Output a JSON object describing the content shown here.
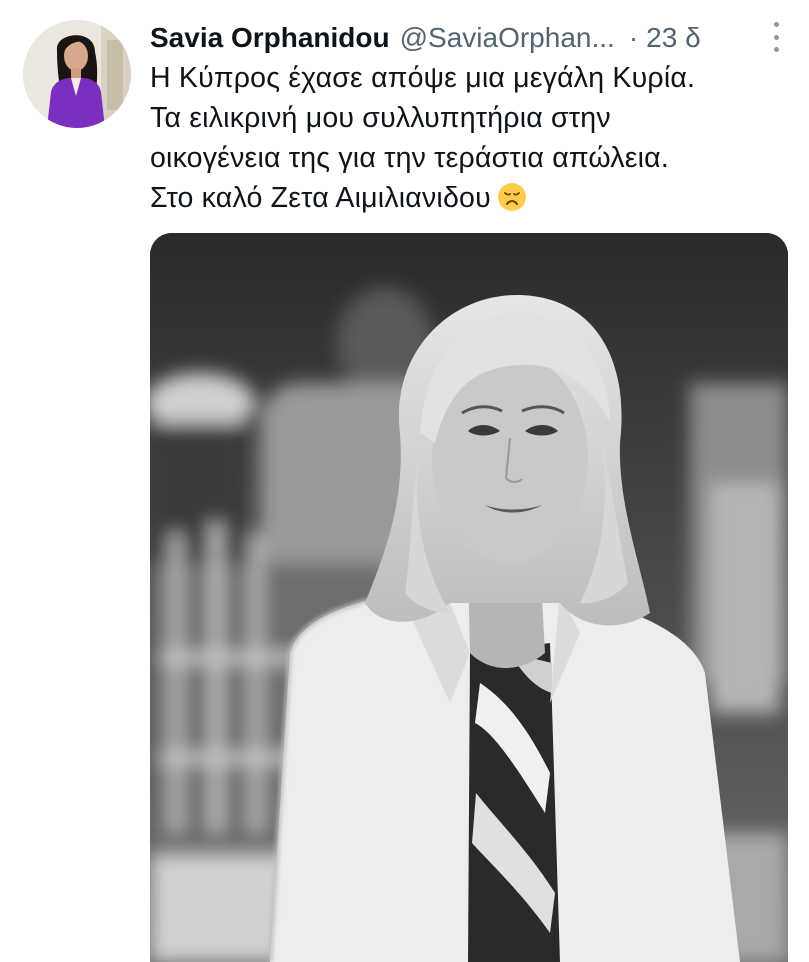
{
  "tweet": {
    "author": {
      "name": "Savia Orphanidou",
      "handle": "@SaviaOrphan...",
      "separator": "·",
      "time": "23 δ"
    },
    "text_lines": [
      "Η Κύπρος έχασε απόψε μια μεγάλη Κυρία.",
      "Τα ειλικρινή μου συλλυπητήρια στην",
      "οικογένεια της για την τεράστια απώλεια.",
      "Στο καλό Ζετα Αιμιλιανιδου"
    ],
    "emoji": "disappointed-face-icon"
  },
  "colors": {
    "text": "#0f1419",
    "secondary": "#536471",
    "avatar_outfit": "#7b2fbf"
  }
}
